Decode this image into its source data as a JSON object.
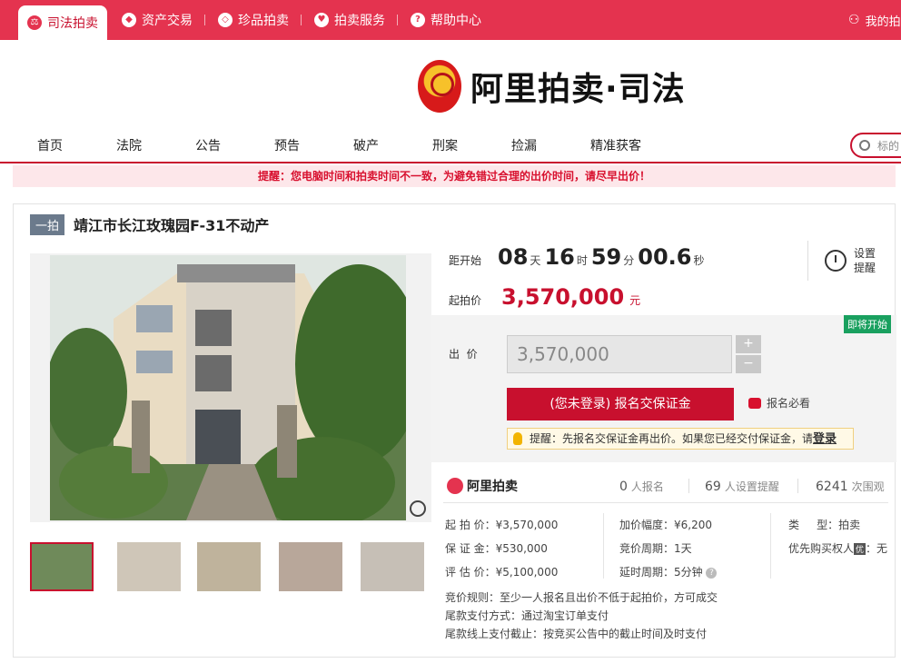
{
  "topbar": {
    "tabs": [
      {
        "label": "司法拍卖",
        "icon": "judicial-icon"
      },
      {
        "label": "资产交易",
        "icon": "asset-icon"
      },
      {
        "label": "珍品拍卖",
        "icon": "gem-icon"
      },
      {
        "label": "拍卖服务",
        "icon": "heart-icon"
      },
      {
        "label": "帮助中心",
        "icon": "help-icon"
      }
    ],
    "account": "我的拍"
  },
  "logo": {
    "text": "阿里拍卖·司法"
  },
  "nav": {
    "items": [
      "首页",
      "法院",
      "公告",
      "预告",
      "破产",
      "刑案",
      "捡漏",
      "精准获客"
    ],
    "search_placeholder": "标的"
  },
  "warning": "提醒：您电脑时间和拍卖时间不一致，为避免错过合理的出价时间，请尽早出价！",
  "item": {
    "badge": "一拍",
    "title": "靖江市长江玫瑰园F-31不动产"
  },
  "countdown": {
    "label": "距开始",
    "days": "08",
    "days_unit": "天",
    "hours": "16",
    "hours_unit": "时",
    "minutes": "59",
    "minutes_unit": "分",
    "seconds": "00.6",
    "seconds_unit": "秒"
  },
  "remind": {
    "line1": "设置",
    "line2": "提醒"
  },
  "start": {
    "label": "起拍价",
    "price": "3,570,000",
    "unit": "元"
  },
  "bid": {
    "status_badge": "即将开始",
    "label": "出  价",
    "value": "3,570,000",
    "plus": "+",
    "minus": "−",
    "signup_button": "(您未登录) 报名交保证金",
    "must_read": "报名必看",
    "tip_text": "提醒：先报名交保证金再出价。如果您已经交付保证金，请",
    "tip_link": "登录"
  },
  "stats": {
    "brand": "阿里拍卖",
    "registered_count": "0",
    "registered_label": "人报名",
    "remind_count": "69",
    "remind_label": "人设置提醒",
    "views_count": "6241",
    "views_label": "次围观"
  },
  "details": {
    "start_price": "起 拍 价：¥3,570,000",
    "deposit": "保 证 金：¥530,000",
    "appraisal": "评 估 价：¥5,100,000",
    "increment": "加价幅度：¥6,200",
    "cycle": "竞价周期：1天",
    "extension": "延时周期：5分钟",
    "type": "类     型：拍卖",
    "priority": "优先购买权人",
    "priority_tag": "优",
    "priority_value": "：无",
    "rule": "竞价规则：至少一人报名且出价不低于起拍价，方可成交",
    "payment": "尾款支付方式：通过淘宝订单支付",
    "deadline": "尾款线上支付截止：按竞买公告中的截止时间及时支付"
  }
}
